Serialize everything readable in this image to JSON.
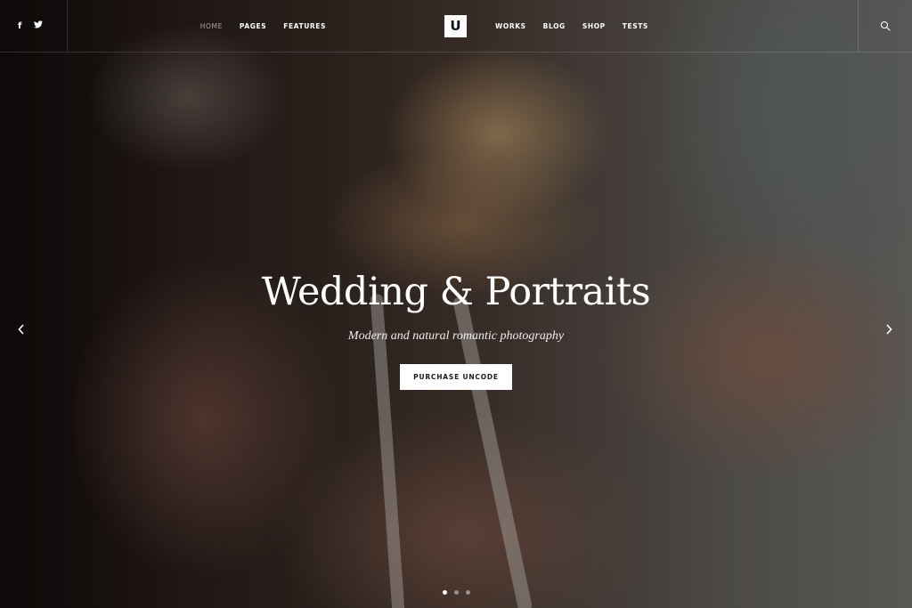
{
  "header": {
    "social": [
      {
        "name": "facebook-icon",
        "glyph": "f"
      },
      {
        "name": "twitter-icon",
        "glyph": "🐦"
      }
    ],
    "nav_left": [
      {
        "label": "HOME",
        "active": true
      },
      {
        "label": "PAGES",
        "active": false
      },
      {
        "label": "FEATURES",
        "active": false
      }
    ],
    "logo": "U",
    "nav_right": [
      {
        "label": "WORKS",
        "active": false
      },
      {
        "label": "BLOG",
        "active": false
      },
      {
        "label": "SHOP",
        "active": false
      },
      {
        "label": "TESTS",
        "active": false
      }
    ],
    "search_icon": "search-icon"
  },
  "hero": {
    "title": "Wedding & Portraits",
    "subtitle": "Modern and natural romantic photography",
    "cta_label": "PURCHASE UNCODE"
  },
  "slider": {
    "prev_icon": "chevron-left-icon",
    "next_icon": "chevron-right-icon",
    "slide_count": 3,
    "active_index": 0
  },
  "colors": {
    "text": "#ffffff",
    "button_bg": "#ffffff",
    "button_text": "#1a1a1a"
  }
}
